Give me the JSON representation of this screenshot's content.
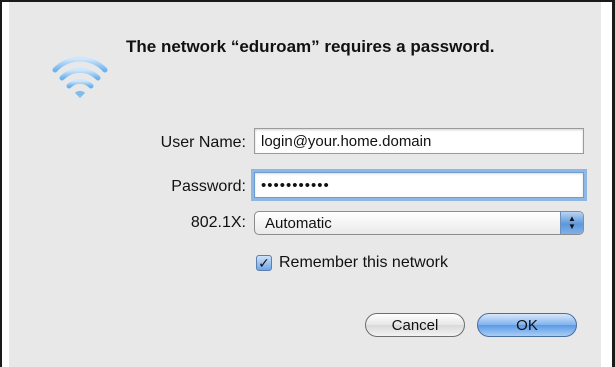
{
  "dialog": {
    "title": "The network “eduroam” requires a password.",
    "icon": "wifi-icon",
    "accent_color": "#5b9ae6"
  },
  "form": {
    "username_label": "User Name:",
    "username_value": "login@your.home.domain",
    "password_label": "Password:",
    "password_mask": "•••••••••••",
    "auth_label": "802.1X:",
    "auth_value": "Automatic",
    "remember_label": "Remember this network",
    "remember_checked": true
  },
  "buttons": {
    "cancel": "Cancel",
    "ok": "OK"
  }
}
